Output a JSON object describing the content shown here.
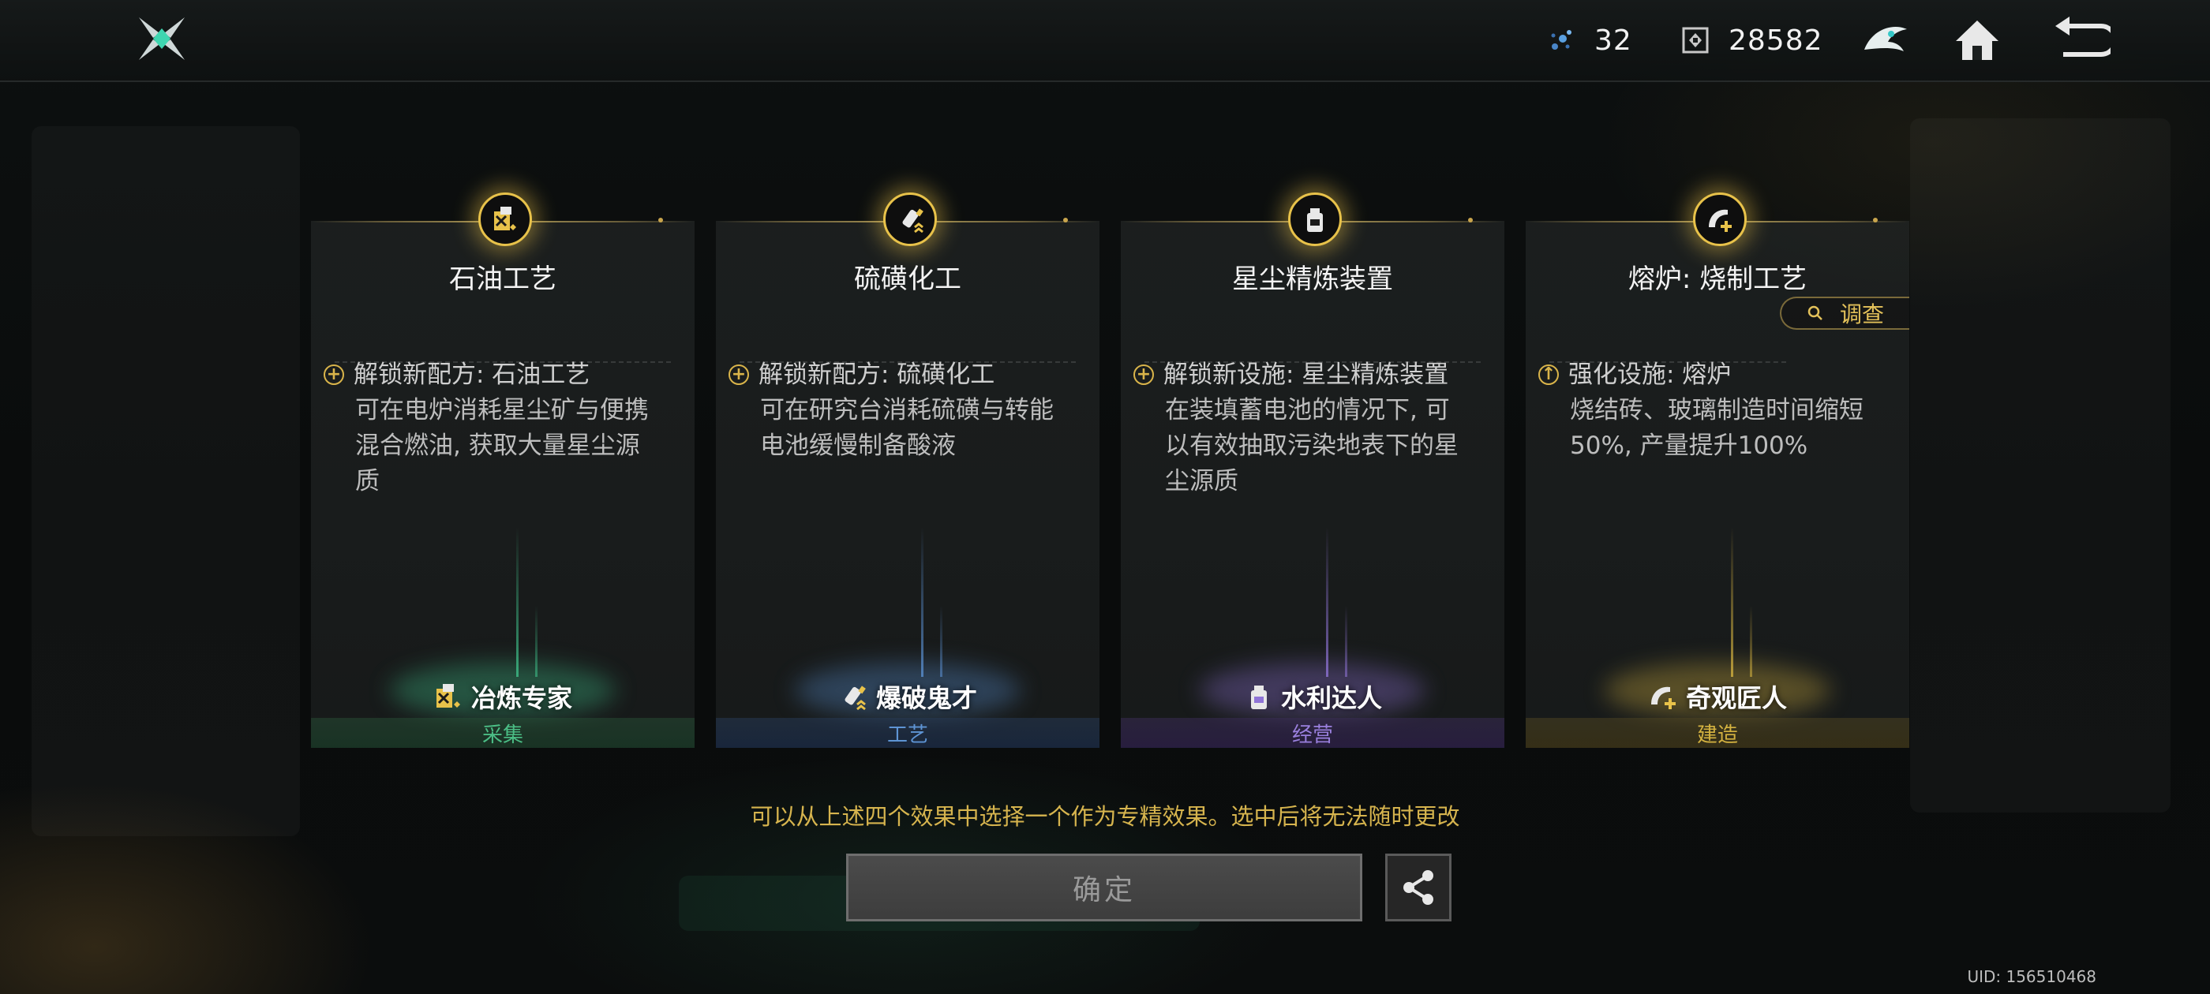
{
  "header": {
    "resource_1_value": "32",
    "resource_2_value": "28582",
    "icons": [
      "app-logo-icon",
      "stardust-icon",
      "data-cube-icon",
      "mascot-icon",
      "home-icon",
      "back-icon"
    ]
  },
  "cards": [
    {
      "title": "石油工艺",
      "effect_title": "解锁新配方: 石油工艺",
      "effect_icon": "plus-icon",
      "effect_lines": [
        "可在电炉消耗星尘矿与便携",
        "混合燃油, 获取大量星尘源",
        "质"
      ],
      "badge": "冶炼专家",
      "category": "采集",
      "accent": "#3fc08a"
    },
    {
      "title": "硫磺化工",
      "effect_title": "解锁新配方: 硫磺化工",
      "effect_icon": "plus-icon",
      "effect_lines": [
        "可在研究台消耗硫磺与转能",
        "电池缓慢制备酸液"
      ],
      "badge": "爆破鬼才",
      "category": "工艺",
      "accent": "#5a8fd0"
    },
    {
      "title": "星尘精炼装置",
      "effect_title": "解锁新设施: 星尘精炼装置",
      "effect_icon": "plus-icon",
      "effect_lines": [
        "在装填蓄电池的情况下, 可",
        "以有效抽取污染地表下的星",
        "尘源质"
      ],
      "badge": "水利达人",
      "category": "经营",
      "accent": "#8f74d6"
    },
    {
      "title": "熔炉: 烧制工艺",
      "effect_title": "强化设施: 熔炉",
      "effect_icon": "upgrade-icon",
      "effect_lines": [
        "烧结砖、玻璃制造时间缩短",
        "50%, 产量提升100%"
      ],
      "badge": "奇观匠人",
      "category": "建造",
      "accent": "#d4b240",
      "search_label": "调查"
    }
  ],
  "note": "可以从上述四个效果中选择一个作为专精效果。选中后将无法随时更改",
  "confirm_label": "确定",
  "uid": "UID: 156510468",
  "colors": {
    "gold": "#e8c24a",
    "note_gold": "#d6b44e"
  }
}
